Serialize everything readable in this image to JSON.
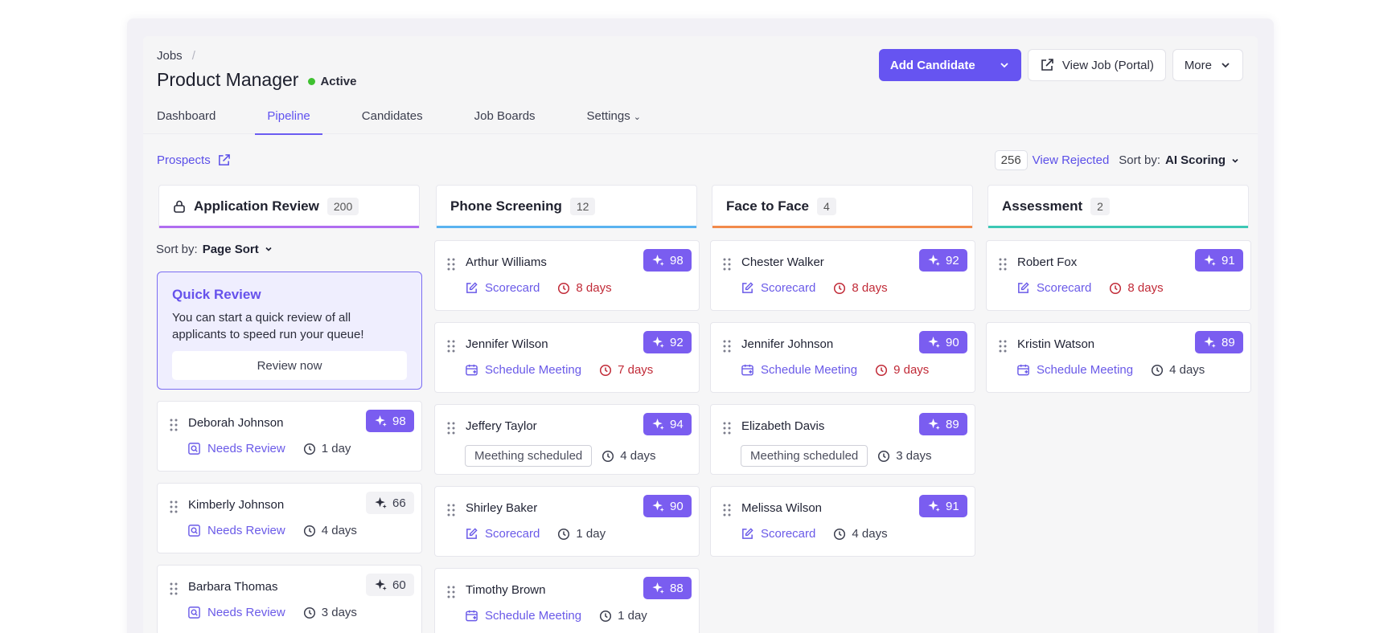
{
  "header": {
    "breadcrumb": "Jobs",
    "title": "Product Manager",
    "status": "Active",
    "tabs": [
      {
        "label": "Dashboard"
      },
      {
        "label": "Pipeline"
      },
      {
        "label": "Candidates"
      },
      {
        "label": "Job Boards"
      },
      {
        "label": "Settings"
      }
    ],
    "add_candidate": "Add Candidate",
    "view_job": "View Job (Portal)",
    "more": "More"
  },
  "toolbar": {
    "prospects": "Prospects",
    "rejected_count": "256",
    "view_rejected": "View Rejected",
    "sort_label": "Sort by:",
    "sort_value": "AI Scoring"
  },
  "columns": [
    {
      "title": "Application Review",
      "count": "200",
      "sort_label": "Sort by:",
      "sort_value": "Page Sort",
      "quick_review": {
        "title": "Quick Review",
        "text": "You can start a quick review of all applicants to speed run your queue!",
        "button": "Review now"
      },
      "cards": [
        {
          "name": "Deborah Johnson",
          "score": "98",
          "action": "Needs Review",
          "time": "1 day"
        },
        {
          "name": "Kimberly Johnson",
          "score": "66",
          "action": "Needs Review",
          "time": "4 days"
        },
        {
          "name": "Barbara Thomas",
          "score": "60",
          "action": "Needs Review",
          "time": "3 days"
        }
      ]
    },
    {
      "title": "Phone Screening",
      "count": "12",
      "cards": [
        {
          "name": "Arthur Williams",
          "score": "98",
          "action": "Scorecard",
          "time": "8 days"
        },
        {
          "name": "Jennifer Wilson",
          "score": "92",
          "action": "Schedule Meeting",
          "time": "7 days"
        },
        {
          "name": "Jeffery Taylor",
          "score": "94",
          "action": "Meething scheduled",
          "time": "4 days"
        },
        {
          "name": "Shirley Baker",
          "score": "90",
          "action": "Scorecard",
          "time": "1 day"
        },
        {
          "name": "Timothy Brown",
          "score": "88",
          "action": "Schedule Meeting",
          "time": "1 day"
        }
      ]
    },
    {
      "title": "Face to Face",
      "count": "4",
      "cards": [
        {
          "name": "Chester Walker",
          "score": "92",
          "action": "Scorecard",
          "time": "8 days"
        },
        {
          "name": "Jennifer Johnson",
          "score": "90",
          "action": "Schedule Meeting",
          "time": "9 days"
        },
        {
          "name": "Elizabeth Davis",
          "score": "89",
          "action": "Meething scheduled",
          "time": "3 days"
        },
        {
          "name": "Melissa Wilson",
          "score": "91",
          "action": "Scorecard",
          "time": "4 days"
        }
      ]
    },
    {
      "title": "Assessment",
      "count": "2",
      "cards": [
        {
          "name": "Robert Fox",
          "score": "91",
          "action": "Scorecard",
          "time": "8 days"
        },
        {
          "name": "Kristin Watson",
          "score": "89",
          "action": "Schedule Meeting",
          "time": "4 days"
        }
      ]
    }
  ],
  "colors": {
    "accent": "#6654f1",
    "score_bg": "#7a5df0",
    "overdue": "#c12a37"
  }
}
